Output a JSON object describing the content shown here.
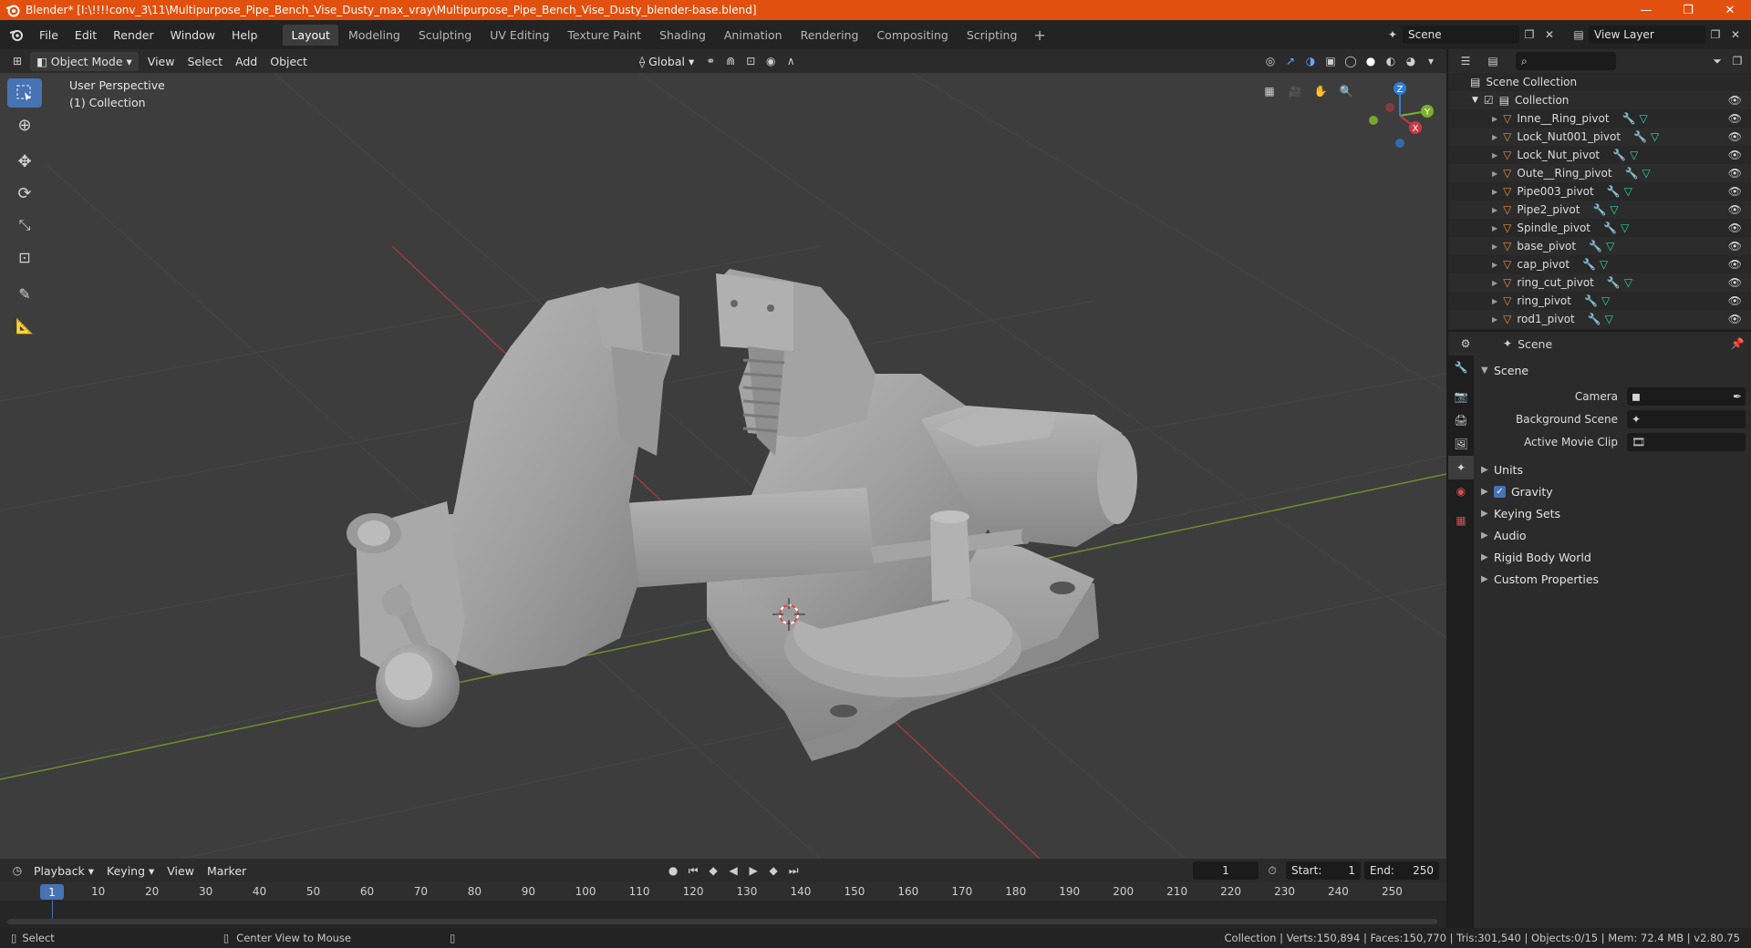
{
  "window": {
    "title": "Blender* [I:\\!!!!conv_3\\11\\Multipurpose_Pipe_Bench_Vise_Dusty_max_vray\\Multipurpose_Pipe_Bench_Vise_Dusty_blender-base.blend]",
    "minimize": "—",
    "maximize": "❐",
    "close": "✕"
  },
  "menu": [
    "File",
    "Edit",
    "Render",
    "Window",
    "Help"
  ],
  "workspaces": [
    "Layout",
    "Modeling",
    "Sculpting",
    "UV Editing",
    "Texture Paint",
    "Shading",
    "Animation",
    "Rendering",
    "Compositing",
    "Scripting"
  ],
  "active_workspace": "Layout",
  "scene_field": "Scene",
  "view_layer_field": "View Layer",
  "viewport_header": {
    "mode": "Object Mode",
    "menus": [
      "View",
      "Select",
      "Add",
      "Object"
    ],
    "transform_orientation": "Global"
  },
  "viewport": {
    "perspective": "User Perspective",
    "collection": "(1) Collection",
    "gizmo": {
      "z": "Z",
      "y": "Y",
      "x": "X"
    }
  },
  "outliner": {
    "root": "Scene Collection",
    "collection": "Collection",
    "objects": [
      "Inne__Ring_pivot",
      "Lock_Nut001_pivot",
      "Lock_Nut_pivot",
      "Oute__Ring_pivot",
      "Pipe003_pivot",
      "Pipe2_pivot",
      "Spindle_pivot",
      "base_pivot",
      "cap_pivot",
      "ring_cut_pivot",
      "ring_pivot",
      "rod1_pivot"
    ]
  },
  "properties": {
    "header": "Scene",
    "section": "Scene",
    "fields": [
      {
        "label": "Camera"
      },
      {
        "label": "Background Scene"
      },
      {
        "label": "Active Movie Clip"
      }
    ],
    "panels": [
      "Units",
      "Gravity",
      "Keying Sets",
      "Audio",
      "Rigid Body World",
      "Custom Properties"
    ],
    "gravity_checked": true
  },
  "timeline": {
    "menus": [
      "Playback",
      "Keying",
      "View",
      "Marker"
    ],
    "current_frame": "1",
    "start_label": "Start:",
    "start": "1",
    "end_label": "End:",
    "end": "250",
    "ticks": [
      "1",
      "10",
      "20",
      "30",
      "40",
      "50",
      "60",
      "70",
      "80",
      "90",
      "100",
      "110",
      "120",
      "130",
      "140",
      "150",
      "160",
      "170",
      "180",
      "190",
      "200",
      "210",
      "220",
      "230",
      "240",
      "250"
    ]
  },
  "statusbar": {
    "left1": "Select",
    "left2": "Center View to Mouse",
    "stats": "Collection | Verts:150,894 | Faces:150,770 | Tris:301,540 | Objects:0/15 | Mem: 72.4 MB | v2.80.75"
  },
  "colors": {
    "title_bar": "#e2500f",
    "accent": "#4772b3",
    "object_icon": "#e8913a",
    "mesh_icon": "#2fd4a4",
    "modifier_icon": "#6ba6ff",
    "axis_x": "#c93a47",
    "axis_y": "#7db02c",
    "axis_z": "#2d7ed8"
  }
}
